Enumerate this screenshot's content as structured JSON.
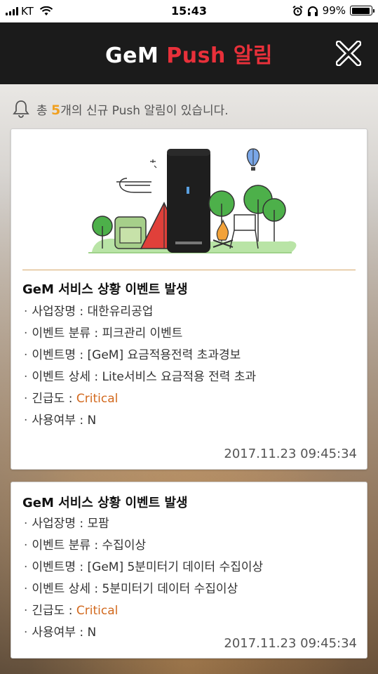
{
  "status_bar": {
    "carrier": "KT",
    "time": "15:43",
    "battery": "99%",
    "battery_level": 0.99
  },
  "header": {
    "brand": "GeM",
    "title": "Push 알림",
    "close_icon": "close-icon"
  },
  "notice": {
    "prefix": "총 ",
    "count": "5",
    "suffix": "개의 신규 Push 알림이 있습니다.",
    "icon": "bell-icon"
  },
  "colors": {
    "header_bg": "#1b1b1b",
    "accent_red": "#e8303a",
    "count_orange": "#f0a020",
    "critical": "#d2691e"
  },
  "notifications": [
    {
      "has_image": true,
      "title": "GeM 서비스 상황 이벤트 발생",
      "rows": [
        {
          "label": "사업장명 : ",
          "value": "대한유리공업"
        },
        {
          "label": "이벤트 분류 : ",
          "value": "피크관리 이벤트"
        },
        {
          "label": "이벤트명 : ",
          "value": "[GeM] 요금적용전력 초과경보"
        },
        {
          "label": "이벤트 상세 : ",
          "value": "Lite서비스 요금적용 전력 초과"
        },
        {
          "label": "긴급도 : ",
          "value": "Critical"
        },
        {
          "label": "사용여부 : ",
          "value": "N"
        }
      ],
      "timestamp": "2017.11.23 09:45:34"
    },
    {
      "has_image": false,
      "title": "GeM 서비스 상황 이벤트 발생",
      "rows": [
        {
          "label": "사업장명 : ",
          "value": "모팜"
        },
        {
          "label": "이벤트 분류 : ",
          "value": "수집이상"
        },
        {
          "label": "이벤트명 : ",
          "value": "[GeM] 5분미터기 데이터 수집이상"
        },
        {
          "label": "이벤트 상세 : ",
          "value": "5분미터기 데이터 수집이상"
        },
        {
          "label": "긴급도 : ",
          "value": "Critical"
        },
        {
          "label": "사용여부 : ",
          "value": "N"
        }
      ],
      "timestamp": "2017.11.23 09:45:34"
    }
  ]
}
